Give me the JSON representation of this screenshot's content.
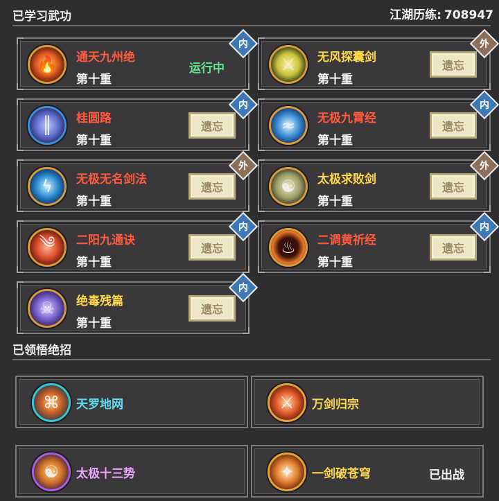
{
  "header": {
    "learned_title": "已学习武功",
    "exp_label": "江湖历练:",
    "exp_value": "708947"
  },
  "skills": [
    {
      "name": "通天九州绝",
      "name_color": "red",
      "level": "第十重",
      "type": "内",
      "status": "运行中",
      "icon": "flame-icon",
      "icon_ring": "orange"
    },
    {
      "name": "无风探囊剑",
      "name_color": "yellow",
      "level": "第十重",
      "type": "外",
      "action": "遗忘",
      "icon": "sword-icon",
      "icon_ring": "orange"
    },
    {
      "name": "桂圆路",
      "name_color": "red",
      "level": "第十重",
      "type": "内",
      "action": "遗忘",
      "icon": "pillar-icon",
      "icon_ring": "blue"
    },
    {
      "name": "无极九霄经",
      "name_color": "red",
      "level": "第十重",
      "type": "内",
      "action": "遗忘",
      "icon": "wave-icon",
      "icon_ring": "orange"
    },
    {
      "name": "无极无名剑法",
      "name_color": "red",
      "level": "第十重",
      "type": "外",
      "action": "遗忘",
      "icon": "lightning-icon",
      "icon_ring": "orange"
    },
    {
      "name": "太极求败剑",
      "name_color": "yellow",
      "level": "第十重",
      "type": "外",
      "action": "遗忘",
      "icon": "taiji-icon",
      "icon_ring": "orange"
    },
    {
      "name": "二阳九通诀",
      "name_color": "red",
      "level": "第十重",
      "type": "内",
      "action": "遗忘",
      "icon": "swirl-icon",
      "icon_ring": "orange"
    },
    {
      "name": "二调黄祈经",
      "name_color": "red",
      "level": "第十重",
      "type": "内",
      "action": "遗忘",
      "icon": "fire-ring-icon",
      "icon_ring": "orange"
    },
    {
      "name": "绝毒残篇",
      "name_color": "yellow",
      "level": "第十重",
      "type": "内",
      "action": "遗忘",
      "icon": "beast-icon",
      "icon_ring": "orange"
    }
  ],
  "ultimates_title": "已领悟绝招",
  "ultimates": [
    {
      "name": "天罗地网",
      "color": "cyan",
      "icon": "net-icon"
    },
    {
      "name": "万剑归宗",
      "color": "yellow",
      "icon": "swords-icon"
    },
    {
      "name": "太极十三势",
      "color": "pink",
      "icon": "yin-yang-icon"
    },
    {
      "name": "一剑破苍穹",
      "color": "yellow",
      "icon": "blade-burst-icon",
      "status": "已出战"
    }
  ],
  "colors": {
    "background": "#2e2d2f",
    "red_name": "#ff5a3c",
    "yellow_name": "#ffd84a",
    "running_green": "#61e58b",
    "inner_badge": "#3d78b4",
    "outer_badge": "#8b6f59",
    "forget_button": "#efe6c6"
  }
}
